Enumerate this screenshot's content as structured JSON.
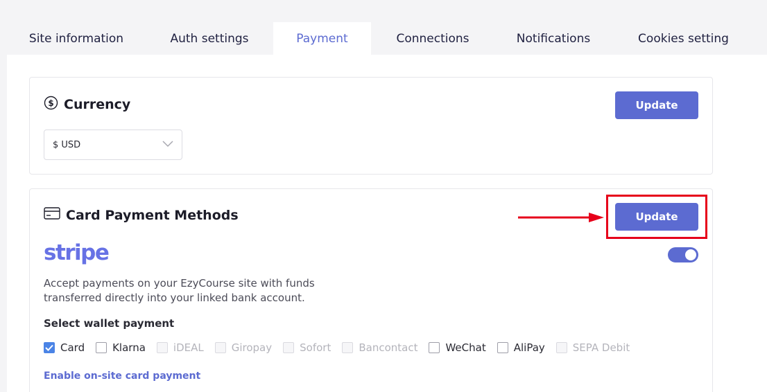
{
  "tabs": [
    {
      "label": "Site information"
    },
    {
      "label": "Auth settings"
    },
    {
      "label": "Payment"
    },
    {
      "label": "Connections"
    },
    {
      "label": "Notifications"
    },
    {
      "label": "Cookies setting"
    }
  ],
  "active_tab": "Payment",
  "currency": {
    "title": "Currency",
    "icon": "dollar-circle-icon",
    "update_label": "Update",
    "selected": "$ USD"
  },
  "card_methods": {
    "title": "Card Payment Methods",
    "icon": "credit-card-icon",
    "update_label": "Update",
    "stripe_logo": "stripe",
    "stripe_enabled": true,
    "description": "Accept payments on your EzyCourse site with funds transferred directly into your linked bank account.",
    "wallet_label": "Select wallet payment",
    "wallets": [
      {
        "label": "Card",
        "checked": true,
        "disabled": false
      },
      {
        "label": "Klarna",
        "checked": false,
        "disabled": false
      },
      {
        "label": "iDEAL",
        "checked": false,
        "disabled": true
      },
      {
        "label": "Giropay",
        "checked": false,
        "disabled": true
      },
      {
        "label": "Sofort",
        "checked": false,
        "disabled": true
      },
      {
        "label": "Bancontact",
        "checked": false,
        "disabled": true
      },
      {
        "label": "WeChat",
        "checked": false,
        "disabled": false
      },
      {
        "label": "AliPay",
        "checked": false,
        "disabled": false
      },
      {
        "label": "SEPA Debit",
        "checked": false,
        "disabled": true
      }
    ],
    "onsite_label": "Enable on-site card payment"
  },
  "colors": {
    "accent": "#5c6bd1",
    "stripe": "#6772e5",
    "annotation": "#e6001a",
    "checkbox": "#4b84e6"
  }
}
